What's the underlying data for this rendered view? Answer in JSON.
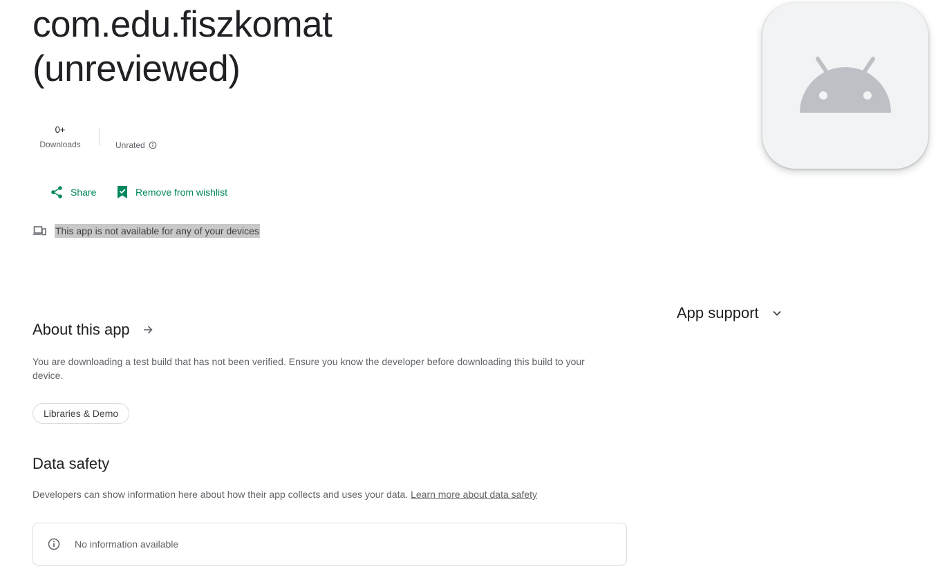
{
  "app": {
    "title_line1": "com.edu.fiszkomat",
    "title_line2": "(unreviewed)",
    "icon": "android-icon"
  },
  "stats": {
    "downloads_value": "0+",
    "downloads_label": "Downloads",
    "rating_label": "Unrated"
  },
  "actions": {
    "share_label": "Share",
    "wishlist_label": "Remove from wishlist"
  },
  "availability": {
    "text": "This app is not available for any of your devices"
  },
  "about": {
    "title": "About this app",
    "description": "You are downloading a test build that has not been verified. Ensure you know the developer before downloading this build to your device.",
    "category_chip": "Libraries & Demo"
  },
  "data_safety": {
    "title": "Data safety",
    "description": "Developers can show information here about how their app collects and uses your data.",
    "link_text": "Learn more about data safety",
    "info_text": "No information available"
  },
  "support": {
    "title": "App support"
  },
  "colors": {
    "accent": "#01875f",
    "text_primary": "#202124",
    "text_secondary": "#5f6368",
    "icon_bg": "#f1f3f4",
    "android_gray": "#bdc1c6"
  }
}
